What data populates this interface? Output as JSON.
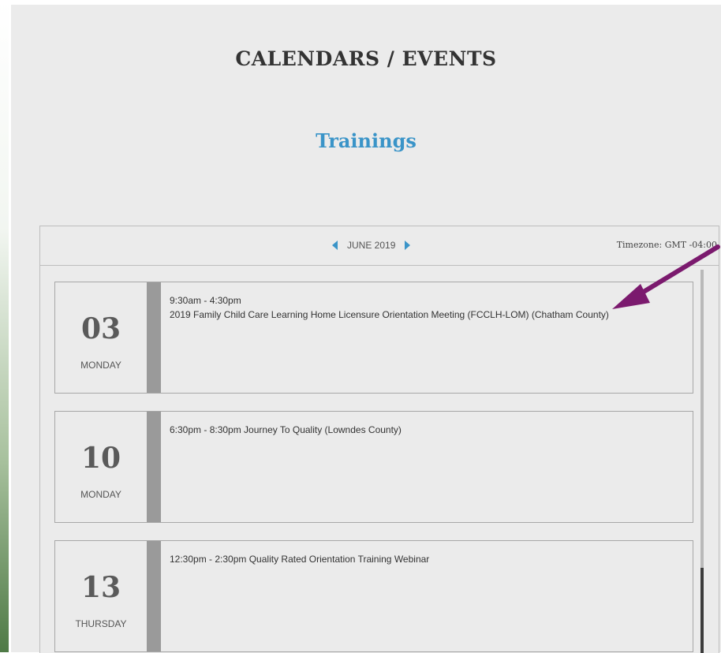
{
  "page": {
    "title": "CALENDARS / EVENTS",
    "subtitle": "Trainings"
  },
  "calendar": {
    "month_label": "JUNE 2019",
    "timezone": "Timezone: GMT -04:00",
    "events": [
      {
        "day": "03",
        "weekday": "MONDAY",
        "lines": [
          "9:30am - 4:30pm",
          "2019 Family Child Care Learning Home Licensure Orientation Meeting (FCCLH-LOM) (Chatham County)"
        ]
      },
      {
        "day": "10",
        "weekday": "MONDAY",
        "lines": [
          "6:30pm - 8:30pm Journey To Quality (Lowndes County)"
        ]
      },
      {
        "day": "13",
        "weekday": "THURSDAY",
        "lines": [
          "12:30pm - 2:30pm Quality Rated Orientation Training Webinar"
        ]
      }
    ]
  },
  "colors": {
    "accent": "#3a94c8",
    "annotation_arrow": "#7b1a6e"
  }
}
